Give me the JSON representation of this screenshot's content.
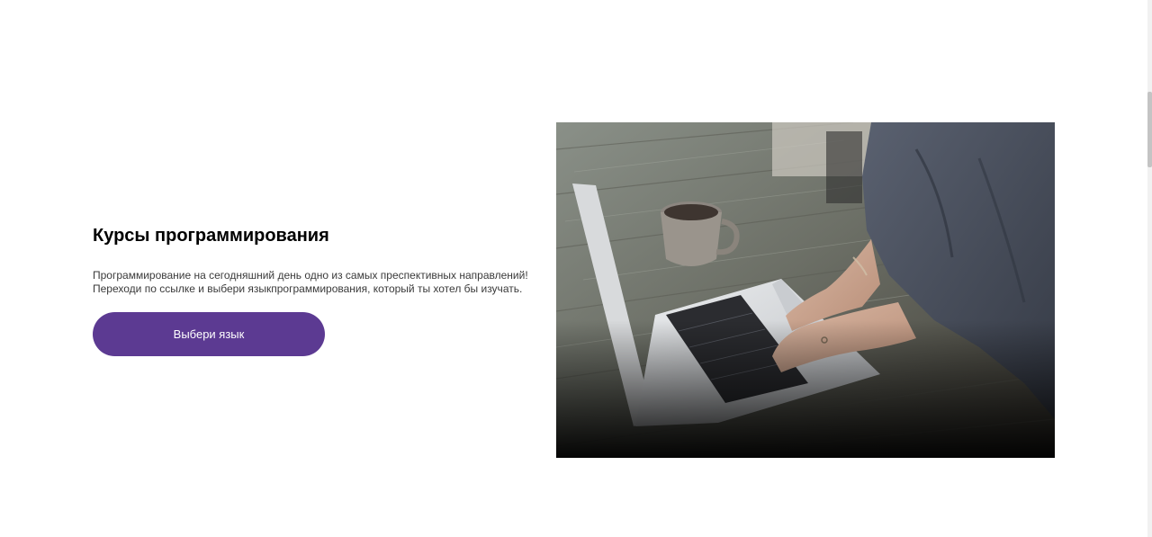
{
  "hero": {
    "title": "Курсы программирования",
    "description_line1": "Программирование на сегодняшний день одно из самых преспективных направлений!",
    "description_line2": "Переходи по ссылке и выбери языкпрограммирования, который ты хотел бы изучать.",
    "cta_label": "Выбери язык"
  },
  "colors": {
    "accent": "#5c3a92",
    "background": "#ffffff",
    "title": "#000000",
    "text": "#3a3a3a"
  },
  "image": {
    "subject": "person typing on laptop with coffee cup on wooden table"
  }
}
